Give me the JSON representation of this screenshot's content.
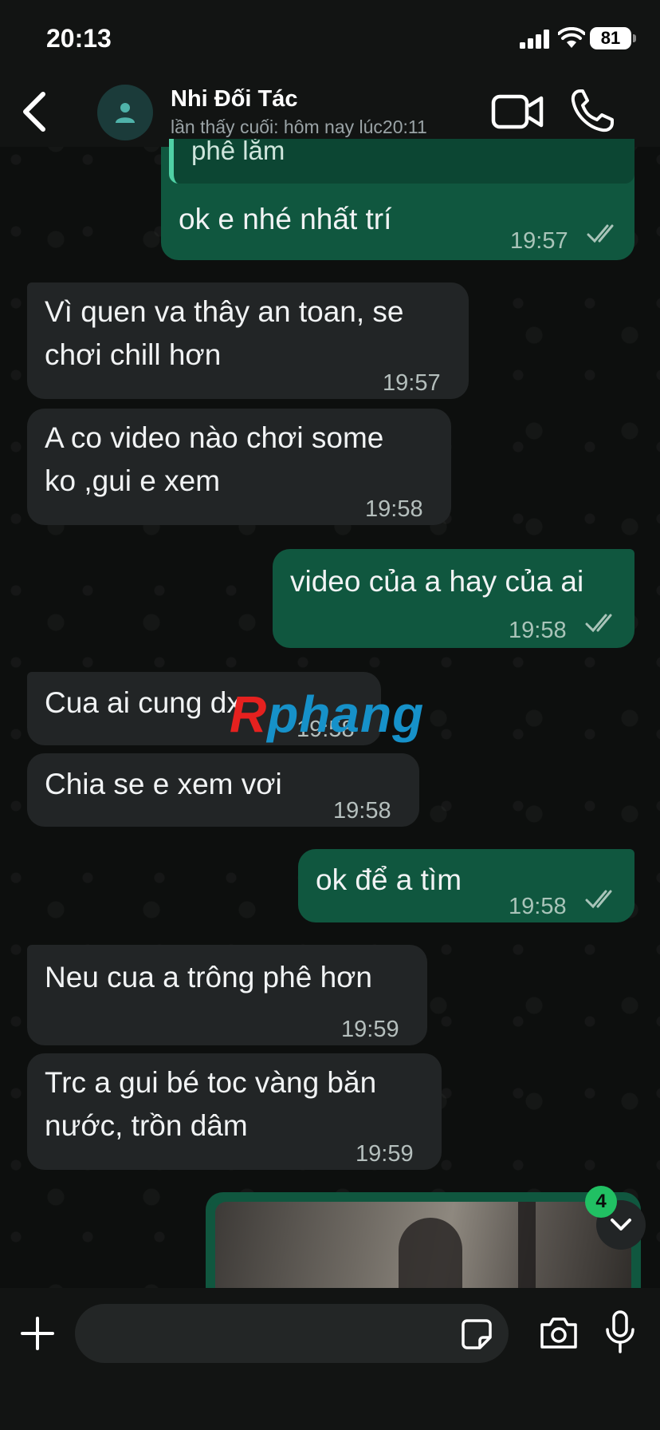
{
  "status_bar": {
    "time": "20:13",
    "battery": "81"
  },
  "header": {
    "contact_name": "Nhi Đối Tác",
    "last_seen": "lần thấy cuối: hôm nay lúc20:11"
  },
  "messages": [
    {
      "dir": "out",
      "quoted_text": "phê lắm",
      "text": "ok e nhé nhất trí",
      "time": "19:57"
    },
    {
      "dir": "in",
      "lines": [
        "Vì quen va thây an toan, se",
        "chơi chill hơn"
      ],
      "time": "19:57"
    },
    {
      "dir": "in",
      "lines": [
        "A co video nào chơi some",
        "ko ,gui e xem"
      ],
      "time": "19:58"
    },
    {
      "dir": "out",
      "text": "video của a hay của ai",
      "time": "19:58"
    },
    {
      "dir": "in",
      "text": "Cua ai cung dx",
      "time": "19:58"
    },
    {
      "dir": "in",
      "text": "Chia se e xem vơi",
      "time": "19:58"
    },
    {
      "dir": "out",
      "text": "ok để a tìm",
      "time": "19:58"
    },
    {
      "dir": "in",
      "text": "Neu cua a trông phê hơn",
      "time": "19:59"
    },
    {
      "dir": "in",
      "lines": [
        "Trc a gui bé toc vàng băn",
        "nước, trồn dâm"
      ],
      "time": "19:59"
    }
  ],
  "watermark": {
    "part1": "R",
    "part2": "phang"
  },
  "scroll_down": {
    "unread_count": "4"
  },
  "composer": {
    "placeholder": ""
  },
  "colors": {
    "outgoing_bubble": "#10573f",
    "incoming_bubble": "#222526",
    "accent": "#21c063"
  }
}
